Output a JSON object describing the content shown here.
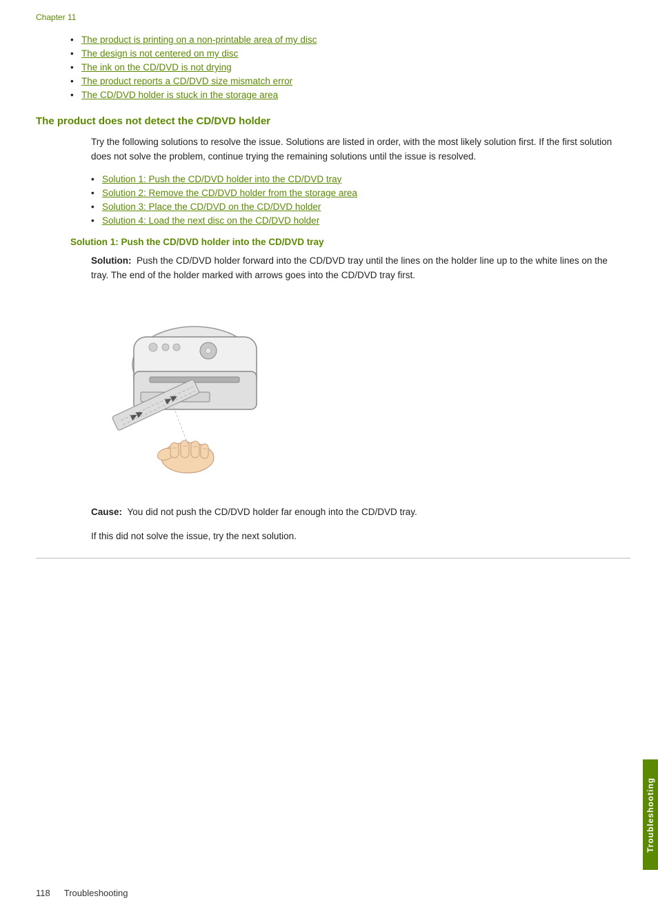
{
  "chapter": {
    "label": "Chapter 11"
  },
  "top_bullets": [
    {
      "text": "The product is printing on a non-printable area of my disc",
      "href": "#"
    },
    {
      "text": "The design is not centered on my disc",
      "href": "#"
    },
    {
      "text": "The ink on the CD/DVD is not drying",
      "href": "#"
    },
    {
      "text": "The product reports a CD/DVD size mismatch error",
      "href": "#"
    },
    {
      "text": "The CD/DVD holder is stuck in the storage area",
      "href": "#"
    }
  ],
  "section": {
    "heading": "The product does not detect the CD/DVD holder",
    "intro": "Try the following solutions to resolve the issue. Solutions are listed in order, with the most likely solution first. If the first solution does not solve the problem, continue trying the remaining solutions until the issue is resolved.",
    "solutions": [
      {
        "text": "Solution 1: Push the CD/DVD holder into the CD/DVD tray",
        "href": "#"
      },
      {
        "text": "Solution 2: Remove the CD/DVD holder from the storage area",
        "href": "#"
      },
      {
        "text": "Solution 3: Place the CD/DVD on the CD/DVD holder",
        "href": "#"
      },
      {
        "text": "Solution 4: Load the next disc on the CD/DVD holder",
        "href": "#"
      }
    ]
  },
  "solution1": {
    "heading": "Solution 1: Push the CD/DVD holder into the CD/DVD tray",
    "solution_label": "Solution:",
    "solution_text": "Push the CD/DVD holder forward into the CD/DVD tray until the lines on the holder line up to the white lines on the tray. The end of the holder marked with arrows goes into the CD/DVD tray first.",
    "cause_label": "Cause:",
    "cause_text": "You did not push the CD/DVD holder far enough into the CD/DVD tray.",
    "next_solution_text": "If this did not solve the issue, try the next solution."
  },
  "footer": {
    "page_number": "118",
    "label": "Troubleshooting"
  },
  "sidebar": {
    "label": "Troubleshooting"
  }
}
